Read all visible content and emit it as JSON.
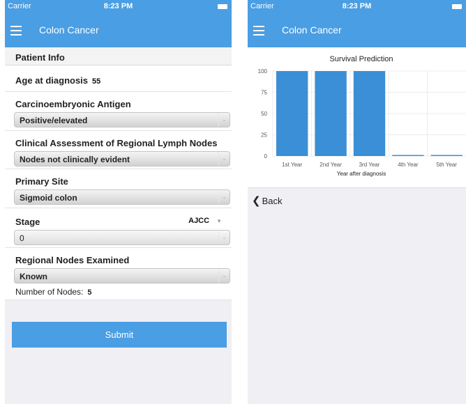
{
  "status": {
    "carrier": "Carrier",
    "time": "8:23 PM"
  },
  "nav": {
    "title": "Colon Cancer"
  },
  "form": {
    "section": "Patient Info",
    "age_label": "Age at diagnosis",
    "age_value": "55",
    "cea_label": "Carcinoembryonic Antigen",
    "cea_value": "Positive/elevated",
    "lymph_label": "Clinical Assessment of Regional Lymph Nodes",
    "lymph_value": "Nodes not clinically evident",
    "site_label": "Primary Site",
    "site_value": "Sigmoid colon",
    "stage_label": "Stage",
    "stage_system": "AJCC",
    "stage_value": "0",
    "regional_label": "Regional Nodes Examined",
    "regional_value": "Known",
    "nodes_label": "Number of Nodes:",
    "nodes_value": "5",
    "submit": "Submit"
  },
  "back_label": "Back",
  "colors": {
    "accent": "#4a9ee3",
    "bar": "#3a8fd6"
  },
  "chart_data": {
    "type": "bar",
    "title": "Survival Prediction",
    "xlabel": "Year after diagnosis",
    "ylabel": "",
    "categories": [
      "1st Year",
      "2nd Year",
      "3rd Year",
      "4th Year",
      "5th Year"
    ],
    "values": [
      100,
      100,
      100,
      0.5,
      0.5
    ],
    "ylim": [
      0,
      100
    ],
    "yticks": [
      0,
      25,
      50,
      75,
      100
    ],
    "grid": true
  }
}
